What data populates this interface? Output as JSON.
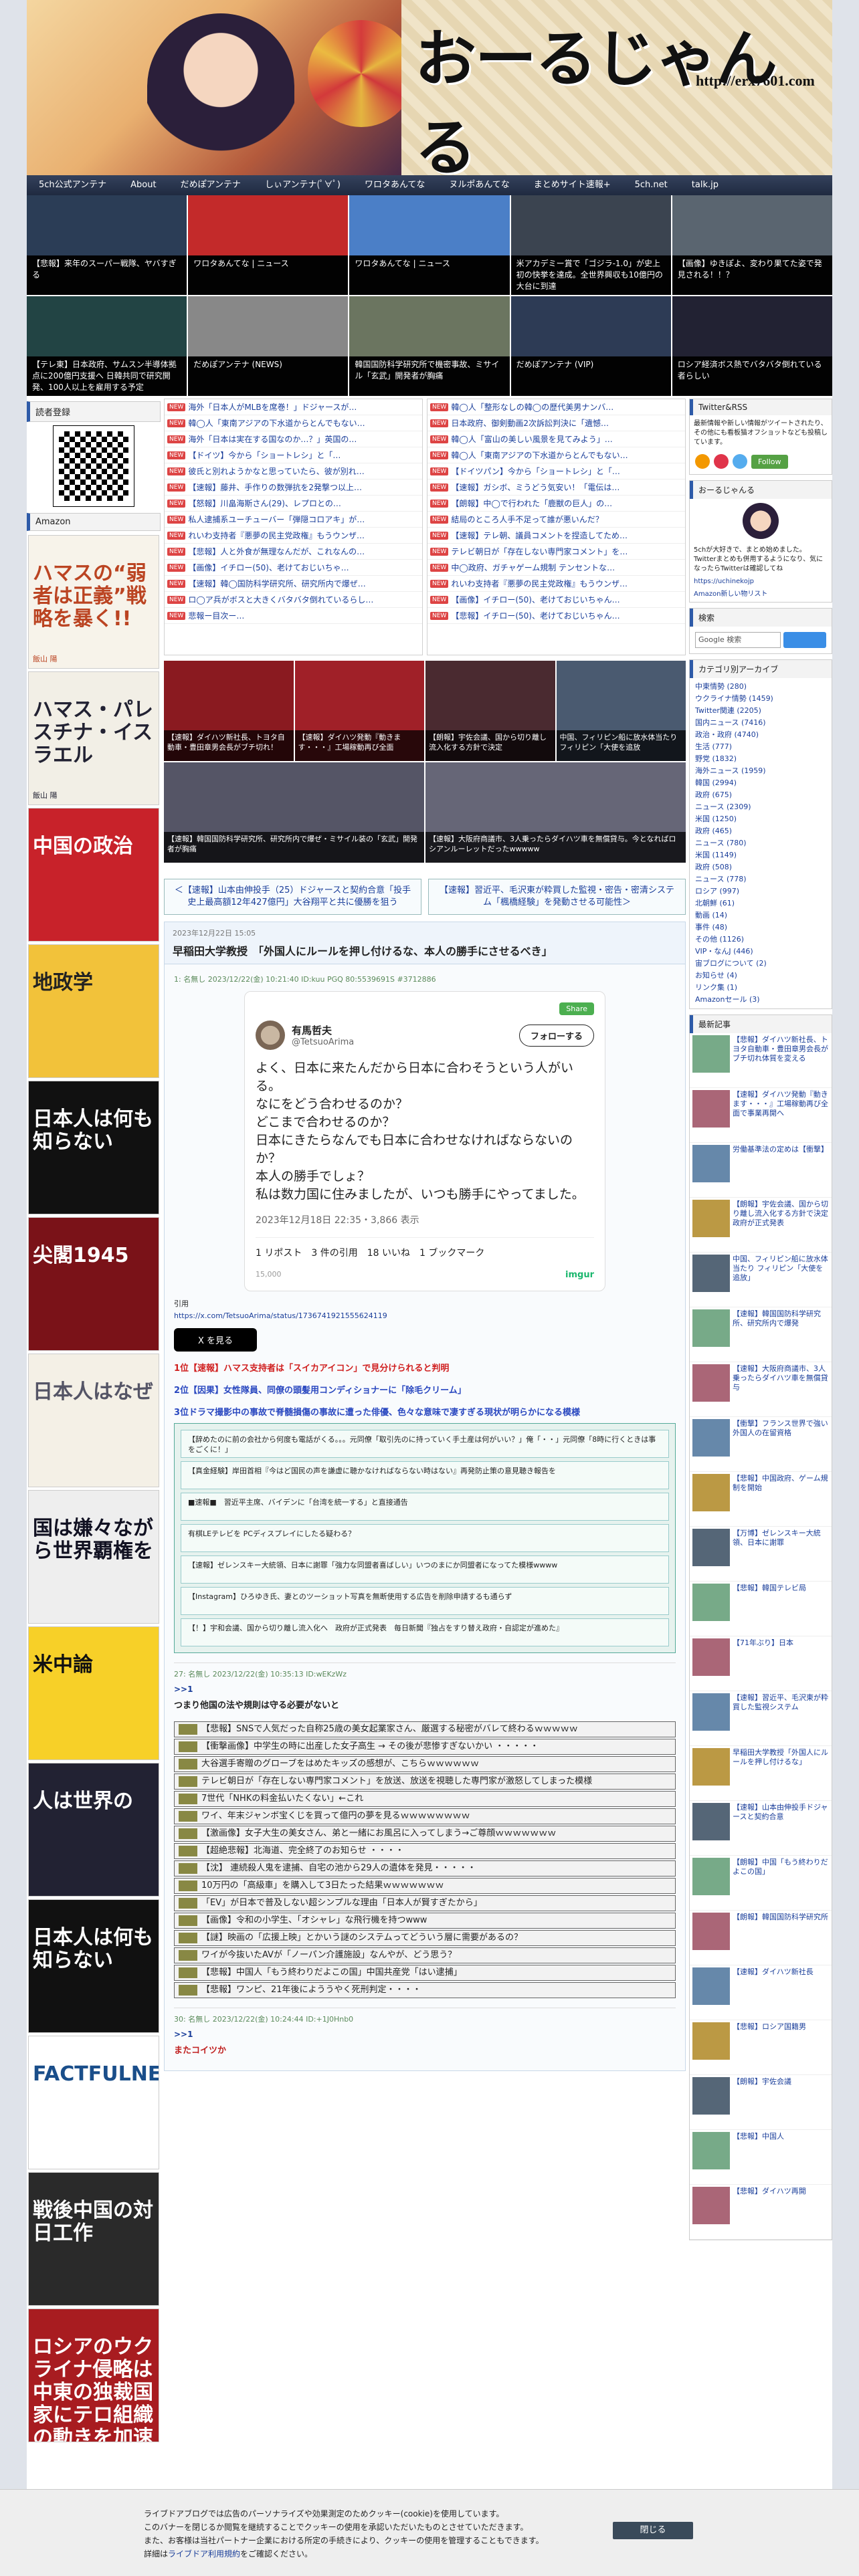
{
  "site": {
    "logo": "おーるじゃんる",
    "url": "http://erx7601.com"
  },
  "nav": [
    "5ch公式アンテナ",
    "About",
    "だめぽアンテナ",
    "しぃアンテナ(ﾟ∀ﾟ)",
    "ワロタあんてな",
    "ヌルポあんてな",
    "まとめサイト速報+",
    "5ch.net",
    "talk.jp"
  ],
  "antenna": [
    {
      "caption": "【悲報】来年のスーパー戦隊、ヤバすぎる",
      "color": "#2b3d56"
    },
    {
      "caption": "ワロタあんてな | ニュース",
      "color": "#c32a2a"
    },
    {
      "caption": "ワロタあんてな | ニュース",
      "color": "#4b7fc7"
    },
    {
      "caption": "米アカデミー賞で「ゴジラ-1.0」が史上初の快挙を達成。全世界興収も10億円の大台に到達",
      "color": "#3b4450"
    },
    {
      "caption": "【画像】ゆきぽよ、変わり果てた姿で発見される！！？",
      "color": "#5a6570"
    },
    {
      "caption": "【テレ東】日本政府、サムスン半導体拠点に200億円支援へ 日韓共同で研究開発、100人以上を雇用する予定",
      "color": "#244"
    },
    {
      "caption": "だめぽアンテナ (NEWS)",
      "color": "#888"
    },
    {
      "caption": "韓国国防科学研究所で機密事故、ミサイル「玄武」開発者が胸痛",
      "color": "#6b7560"
    },
    {
      "caption": "だめぽアンテナ (VIP)",
      "color": "#2d3b55"
    },
    {
      "caption": "ロシア経済ボス熱でバタバタ倒れている者らしい",
      "color": "#223"
    }
  ],
  "left": {
    "reader_head": "読者登録",
    "amazon_head": "Amazon",
    "books": [
      {
        "title": "ハマスの“弱者は正義”戦略を暴く!!",
        "author": "飯山 陽",
        "bg": "#f7f3ea",
        "fg": "#b42"
      },
      {
        "title": "ハマス・パレスチナ・イスラエル",
        "author": "飯山 陽",
        "bg": "#f2efe6",
        "fg": "#223"
      },
      {
        "title": "中国の政治",
        "author": "",
        "bg": "#c8222a",
        "fg": "#fff"
      },
      {
        "title": "地政学",
        "author": "",
        "bg": "#f2c23a",
        "fg": "#222"
      },
      {
        "title": "日本人は何も知らない",
        "author": "",
        "bg": "#111",
        "fg": "#fff"
      },
      {
        "title": "尖閣1945",
        "author": "",
        "bg": "#7a1218",
        "fg": "#fff"
      },
      {
        "title": "日本人はなぜ",
        "author": "",
        "bg": "#f4f0e6",
        "fg": "#556"
      },
      {
        "title": "国は嫌々ながら世界覇権を",
        "author": "",
        "bg": "#eee",
        "fg": "#112"
      },
      {
        "title": "米中論",
        "author": "",
        "bg": "#f7d028",
        "fg": "#111"
      },
      {
        "title": "人は世界の",
        "author": "",
        "bg": "#223",
        "fg": "#fff"
      },
      {
        "title": "日本人は何も知らない",
        "author": "",
        "bg": "#111",
        "fg": "#fff"
      },
      {
        "title": "FACTFULNESS",
        "author": "",
        "bg": "#fff",
        "fg": "#1a4e8a"
      },
      {
        "title": "戦後中国の対日工作",
        "author": "",
        "bg": "#2a2a2a",
        "fg": "#fff"
      },
      {
        "title": "ロシアのウクライナ侵略は中東の独裁国家にテロ組織の動きを加速させる!!",
        "author": "",
        "bg": "#a81c20",
        "fg": "#fff"
      }
    ]
  },
  "headlines_left": [
    "海外「日本人がMLBを席巻！」ドジャースが…",
    "韓◯人「東南アジアの下水道からとんでもない…",
    "海外「日本は実在する国なのか…？」英国の…",
    "【ドイツ】今から「ショートレシ」と「…",
    "彼氏と別れようかなと思っていたら、彼が別れ…",
    "【速報】藤井、手作りの数弾抗を2発撃つ以上…",
    "【怒報】川畠海斯さん(29)、レプロとの…",
    "私人逮捕系ユーチューバー「弾隠コロアキ」が…",
    "れいわ支持者『悪夢の民主党政権』もうウンザ…",
    "【悲報】人と外食が無理なんだが、これなんの…",
    "【画像】イチロー(50)、老けておじいちゃ…",
    "【速報】韓◯国防科学研究所、研究所内で爆ぜ…",
    "ロ◯ア兵がボスと大きくバタバタ倒れているらし…",
    "悲報ー目次ー…"
  ],
  "headlines_right": [
    "韓◯人「整形なしの韓◯の歴代美男ナンバ…",
    "日本政府、御剣動画2次訴訟判決に「遺憾…",
    "韓◯人「富山の美しい風景を見てみよう」…",
    "韓◯人「東南アジアの下水道からとんでもない…",
    "【ドイツパン】今から「ショートレシ」と「…",
    "【速報】ガシボ、ミうどう気安い！「電伝は…",
    "【朗報】中◯で行われた「鹿獣の巨人」の…",
    "結局のところ人手不足って誰が悪いんだ？",
    "【速報】テレ朝、議員コメントを捏造してため…",
    "テレビ朝日が「存在しない専門家コメント」を…",
    "中◯政府、ガチャゲーム規制 テンセントな…",
    "れいわ支持者『悪夢の民主党政権』もうウンザ…",
    "【画像】イチロー(50)、老けておじいちゃん…",
    "【悲報】イチロー(50)、老けておじいちゃん…"
  ],
  "picks": [
    {
      "caption": "【速報】ダイハツ新社長、トヨタ自動車・豊田章男会長がブチ切れ！",
      "color": "#8a1a20"
    },
    {
      "caption": "【速報】ダイハツ発動『動きます・・・』工場稼動再び全面",
      "color": "#a02028"
    },
    {
      "caption": "【朗報】宇佐会議、国から切り離し流入化する方針で決定",
      "color": "#4a2a30"
    },
    {
      "caption": "中国、フィリピン船に放水体当たり フィリピン「大使を追放",
      "color": "#4a5a70"
    },
    {
      "caption": "【速報】韓国国防科学研究所、研究所内で爆ぜ・ミサイル装の「玄武」開発者が胸痛",
      "color": "#556"
    },
    {
      "caption": "【速報】大阪府商議市、3人乗ったらダイハツ車を無償貸与。今となればロシアンルーレットだったwwwww",
      "color": "#667"
    }
  ],
  "pager": {
    "prev": "＜【速報】山本由伸投手（25）ドジャースと契約合意「投手史上最高額12年427億円」大谷翔平と共に優勝を狙う",
    "next": "【速報】習近平、毛沢東が粋買した監視・密告・密清システム「楓橋経験」を発動させる可能性＞"
  },
  "article": {
    "date": "2023年12月22日 15:05",
    "title": "早稲田大学教授　「外国人にルールを押し付けるな、本人の勝手にさせるべき」",
    "res1_head": "1: 名無し 2023/12/22(金) 10:21:40 ID:kuu  PGQ 80:5539691S #3712886",
    "share": "Share",
    "tweet": {
      "name": "有馬哲夫",
      "id": "@TetsuoArima",
      "follow": "フォローする",
      "text": "よく、日本に来たんだから日本に合わそうという人がいる。\nなにをどう合わせるのか？\nどこまで合わせるのか？\n日本にきたらなんでも日本に合わせなければならないのか？\n本人の勝手でしょ？\n私は数力国に住みましたが、いつも勝手にやってました。",
      "time": "2023年12月18日 22:35・3,866 表示",
      "stats": "1 リポスト　3 件の引用　18 いいね　1 ブックマーク",
      "views": "15,000",
      "imgur": "imgur"
    },
    "quote_label": "引用",
    "quote_url": "https://x.com/TetsuoArima/status/1736741921555624119",
    "x_button": "X を見る",
    "ranks": [
      {
        "text": "1位【速報】ハマス支持者は「スイカアイコン」で見分けられると判明",
        "blue": false
      },
      {
        "text": "2位【因果】女性隊員、同僚の頭髪用コンディショナーに「除毛クリーム」",
        "blue": true
      },
      {
        "text": "3位ドラマ撮影中の事故で脊髄損傷の事故に遭った俳優、色々な意味で凄すぎる現状が明らかになる模様",
        "blue": true
      }
    ],
    "related": [
      "【辞めたのに前の会社から何度も電話がくる。。。元同僚「取引先のに持っていく手土産は何がいい？」俺「・・」元同僚「8時に行くときは事をごくに！」",
      "【真金経験】岸田首相『今はど国民の声を謙虚に聴かなければならない時はない』再発防止策の意見聴き報告を",
      "■速報■　習近平主席、バイデンに「台湾を統一する」と直接通告",
      "有棋LEテレビを PCディスプレイにしたる疑わる？",
      "【速報】ゼレンスキー大統領、日本に謝罪「強力な同盟者喜ばしい」いつのまにか同盟者になってた模様wwww",
      "【Instagram】ひろゆき氏、妻とのツーショット写真を無断使用する広告を削除申請するも通らず",
      "【！】宇和会議、国から切り離し流入化へ　政府が正式発表　毎日新聞『独占をすり替え政府・自認定が進めた』"
    ],
    "res2_head": "27: 名無し 2023/12/22(金) 10:35:13 ID:wEKzWz",
    "res2_anchor": ">>1",
    "res2_text": "つまり他国の法や規則は守る必要がないと",
    "others": [
      "【悲報】SNSで人気だった自称25歳の美女起業家さん、厳選する秘密がバレて終わるｗｗｗｗｗ",
      "【衝撃画像】中学生の時に出産した女子高生 → その後が悲惨すぎないかい ・・・・・",
      "大谷選手寄贈のグローブをはめたキッズの感想が、こちらｗｗｗｗｗｗ",
      "テレビ朝日が「存在しない専門家コメント」を放送、放送を視聴した専門家が激怒してしまった模様",
      "7世代「NHKの料金払いたくない」←これ",
      "ワイ、年末ジャンボ宝くじを買って億円の夢を見るｗｗｗｗｗｗｗｗ",
      "【激画像】女子大生の美女さん、弟と一緒にお風呂に入ってしまう→ご尊顔ｗｗｗｗｗｗｗ",
      "【超絶悲報】北海道、完全終了のお知らせ ・・・・",
      "【沈】 連続殺人鬼を逮捕、自宅の池から29人の遺体を発見・・・・・",
      "10万円の「高級車」を購入して3日たった結果ｗｗｗｗｗｗｗ",
      "「EV」が日本で普及しない超シンプルな理由「日本人が賢すぎたから」",
      "【画像】令和の小学生、「オシャレ」な飛行機を持つwww",
      "【謎】映画の「広援上映」とかいう謎のシステムってどういう層に需要があるの？",
      "ワイが今抜いたAVが「ノーパン介護施設」なんやが、どう思う？",
      "【悲報】中国人「もう終わりだよこの国」中国共産党「はい逮捕」",
      "【悲報】ワンピ、21年後によううやく死刑判定・・・・"
    ],
    "res3_head": "30: 名無し 2023/12/22(金) 10:24:44 ID:+1J0Hnb0",
    "res3_anchor": ">>1",
    "res3_text": "またコイツか"
  },
  "right": {
    "twitter_head": "Twitter&RSS",
    "twitter_text": "最新情報や新しい情報がツイートされたり、その他にも看板猫オフショットなども投稿しています。",
    "follow": "Follow",
    "about_head": "おーるじゃんる",
    "about_text": "5chが大好きで、まとめ始めました。Twitterまとめも併用するようになり、気になったらTwitterは確認してね",
    "about_link": "https://uchinekojp",
    "about_sub": "Amazon新しい物リスト",
    "search_head": "検索",
    "search_placeholder": "Google 検索",
    "cat_head": "カテゴリ別アーカイブ",
    "cats": [
      "中東情勢 (280)",
      "ウクライナ情勢 (1459)",
      "Twitter関連 (2205)",
      "国内ニュース (7416)",
      "政治・政府 (4740)",
      "生活 (777)",
      "野党 (1832)",
      "海外ニュース (1959)",
      "韓国 (2994)",
      "政府 (675)",
      "ニュース (2309)",
      "米国 (1250)",
      "政府 (465)",
      "ニュース (780)",
      "米国 (1149)",
      "政府 (508)",
      "ニュース (778)",
      "ロシア (997)",
      "北朝鮮 (61)",
      "動画 (14)",
      "事件 (48)",
      "その他 (1126)",
      "VIP・なんJ (446)",
      "宙ブログについて (2)",
      "お知らせ (4)",
      "リンク集 (1)",
      "Amazonセール (3)"
    ],
    "latest_head": "最新記事",
    "latest": [
      "【悲報】ダイハツ新社長、トヨタ自動車・豊田章男会長がブチ切れ体質を変える",
      "【速報】ダイハツ発動『動きます・・・』工場稼動再び全面で事業再開へ",
      "労働基準法の定めは【衝撃】",
      "【朗報】宇佐会議、国から切り離し流入化する方針で決定 政府が正式発表",
      "中国、フィリピン船に放水体当たり フィリピン「大使を追放」",
      "【速報】韓国国防科学研究所、研究所内で爆発",
      "【速報】大阪府商議市、3人乗ったらダイハツ車を無償貸与",
      "【衝撃】フランス世界で強い外国人の在留資格",
      "【悲報】中国政府、ゲーム規制を開始",
      "【万博】ゼレンスキー大統領、日本に謝罪",
      "【悲報】韓国テレビ局",
      "【71年ぶり】日本",
      "【速報】習近平、毛沢東が粋買した監視システム",
      "早稲田大学教授「外国人にルールを押し付けるな」",
      "【速報】山本由伸投手ドジャースと契約合意",
      "【朗報】中国「もう終わりだよこの国」",
      "【朗報】韓国国防科学研究所",
      "【速報】ダイハツ新社長",
      "【悲報】ロシア国籍男",
      "【朗報】宇佐会議",
      "【悲報】中国人",
      "【悲報】ダイハツ再開"
    ]
  },
  "cookie": {
    "text1": "ライブドアブログでは広告のパーソナライズや効果測定のためクッキー(cookie)を使用しています。",
    "text2": "このバナーを閉じるか閲覧を継続することでクッキーの使用を承認いただいたものとさせていただきます。",
    "text3": "また、お客様は当社パートナー企業における所定の手続きにより、クッキーの使用を管理することもできます。",
    "text4": "詳細は",
    "link": "ライブドア利用規約",
    "text5": "をご確認ください。",
    "close": "閉じる"
  }
}
